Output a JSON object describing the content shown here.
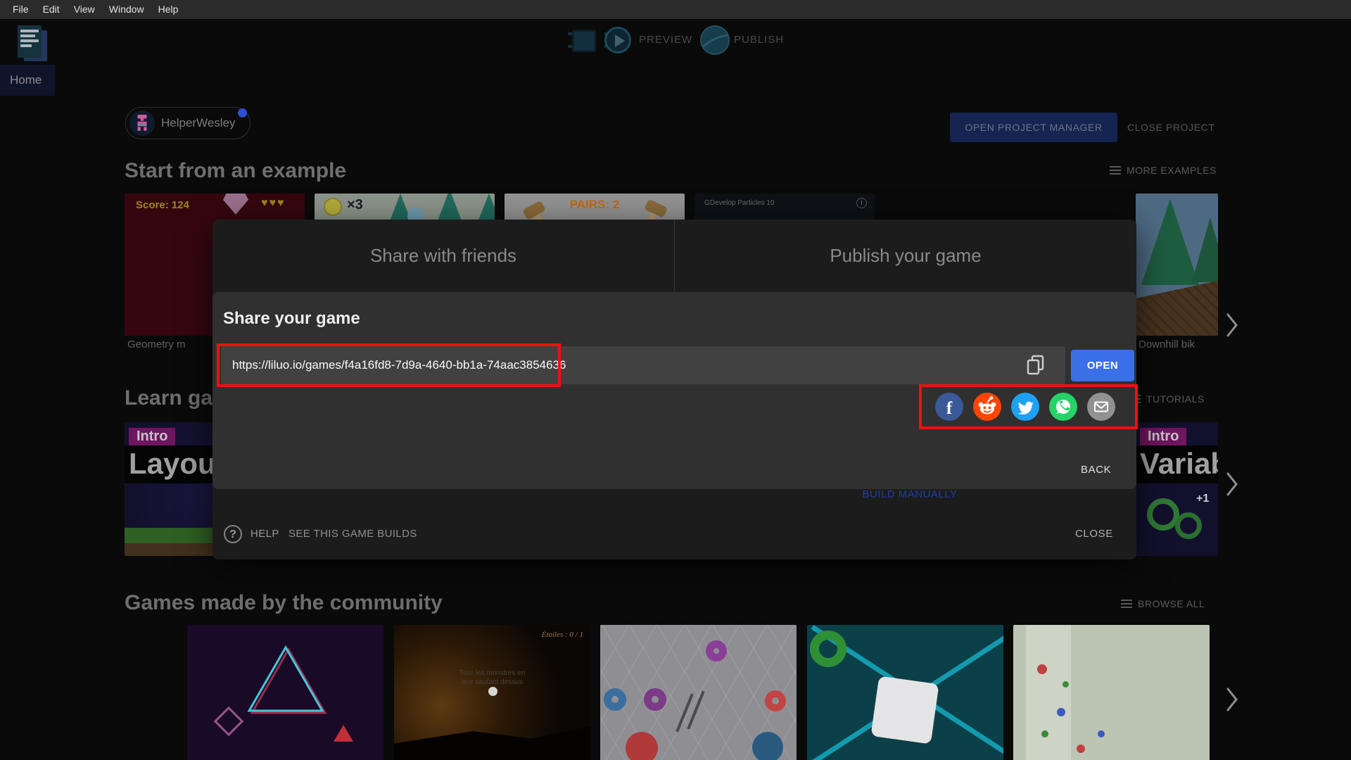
{
  "window": {
    "menu": [
      "File",
      "Edit",
      "View",
      "Window",
      "Help"
    ]
  },
  "toolbar": {
    "preview": "PREVIEW",
    "publish": "PUBLISH"
  },
  "home_tab": "Home",
  "topbar": {
    "username": "HelperWesley",
    "open_project_manager": "OPEN PROJECT MANAGER",
    "close_project": "CLOSE PROJECT"
  },
  "sections": {
    "examples": {
      "title": "Start from an example",
      "action": "MORE EXAMPLES",
      "card_geometry": {
        "score": "Score: 124",
        "hearts": "♥♥♥",
        "caption": "Geometry m"
      },
      "card_platformer": {
        "coin_mult": "×3"
      },
      "card_pairs": {
        "label": "PAIRS: 2"
      },
      "card_particles": {
        "label": "GDevelop Particles 10",
        "info": "i"
      },
      "card_downhill": {
        "caption": "Downhill bik"
      }
    },
    "learn": {
      "title": "Learn ga",
      "action": "TUTORIALS",
      "card_layout": {
        "badge": "Intro",
        "title": "Layou"
      },
      "card_variables": {
        "badge": "Intro",
        "title": "Variab",
        "extra": "+1"
      }
    },
    "community": {
      "title": "Games made by the community",
      "action": "BROWSE ALL",
      "card_night": {
        "score": "Étoiles : 0 / 1",
        "hint1": "Tuer les monstres en",
        "hint2": "leur sautant dessus"
      }
    }
  },
  "dialog": {
    "tab_share": "Share with friends",
    "tab_publish": "Publish your game",
    "share_title": "Share your game",
    "game_url": "https://liluo.io/games/f4a16fd8-7d9a-4640-bb1a-74aac3854636",
    "open_button": "OPEN",
    "back_button": "BACK",
    "build_manually": "BUILD MANUALLY",
    "help": "HELP",
    "see_builds": "SEE THIS GAME BUILDS",
    "close_button": "CLOSE",
    "social": [
      {
        "name": "facebook",
        "color": "#3b5998",
        "css": "background:#3b5998",
        "glyph": "f"
      },
      {
        "name": "reddit",
        "color": "#ff4500",
        "css": "background:#ff4500"
      },
      {
        "name": "twitter",
        "color": "#1da1f2",
        "css": "background:#1da1f2"
      },
      {
        "name": "whatsapp",
        "color": "#25d366",
        "css": "background:#25d366"
      },
      {
        "name": "email",
        "color": "#919191",
        "css": "background:#919191"
      }
    ]
  },
  "colors": {
    "accent_blue": "#3b6fe8",
    "annotation_red": "#ee1111",
    "link_blue": "#1e3ea8",
    "notification_blue": "#2d4fd4"
  }
}
